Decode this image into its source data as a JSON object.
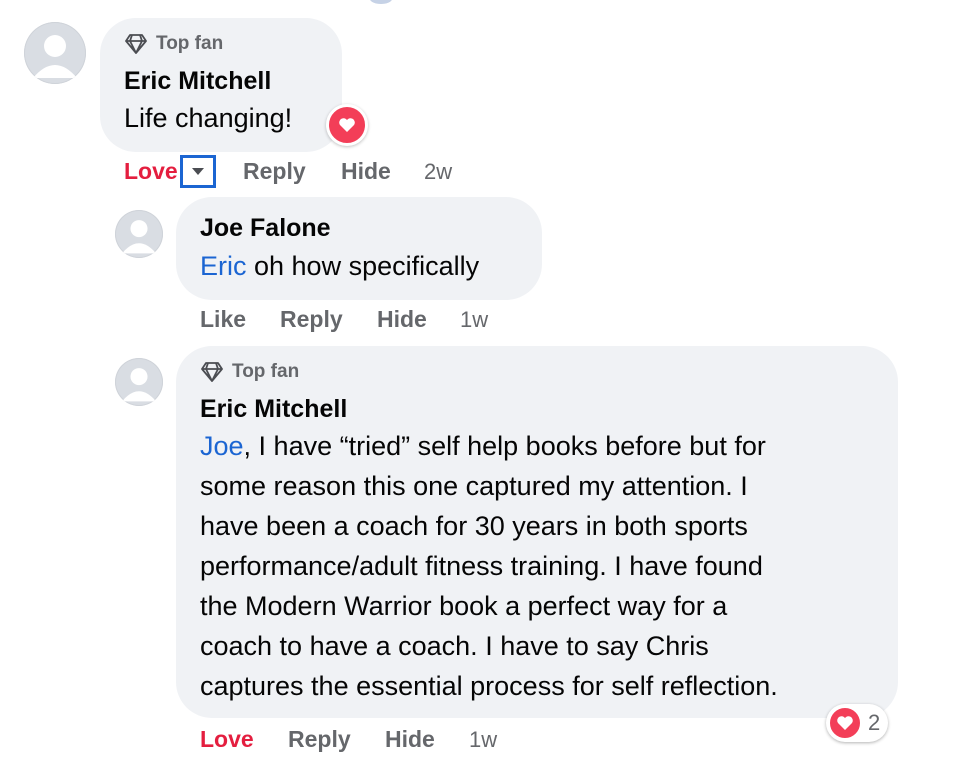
{
  "comments": [
    {
      "badge": "Top fan",
      "badge_icon": "diamond-icon",
      "author": "Eric Mitchell",
      "text": "Life changing!",
      "reaction_icon": "heart-icon",
      "actions": {
        "react": "Love",
        "reply": "Reply",
        "hide": "Hide",
        "time": "2w"
      },
      "dropdown_icon": "chevron-down-icon"
    },
    {
      "author": "Joe Falone",
      "mention": "Eric",
      "text": " oh how specifically",
      "actions": {
        "react": "Like",
        "reply": "Reply",
        "hide": "Hide",
        "time": "1w"
      }
    },
    {
      "badge": "Top fan",
      "badge_icon": "diamond-icon",
      "author": "Eric Mitchell",
      "mention": "Joe",
      "lines": [
        ", I have “tried” self help books before but for",
        "some reason this one captured my attention. I",
        "have been a coach for 30 years in both sports",
        "performance/adult fitness training. I have found",
        "the Modern Warrior book a perfect way for a",
        "coach to have a coach. I have to say Chris",
        "captures the essential process for self reflection."
      ],
      "reaction_icon": "heart-icon",
      "reaction_count": "2",
      "actions": {
        "react": "Love",
        "reply": "Reply",
        "hide": "Hide",
        "time": "1w"
      }
    }
  ],
  "colors": {
    "bubble": "#f0f2f5",
    "love": "#e41e3f",
    "mention": "#1b65d2",
    "muted": "#65676b",
    "heart": "#f33e58"
  }
}
